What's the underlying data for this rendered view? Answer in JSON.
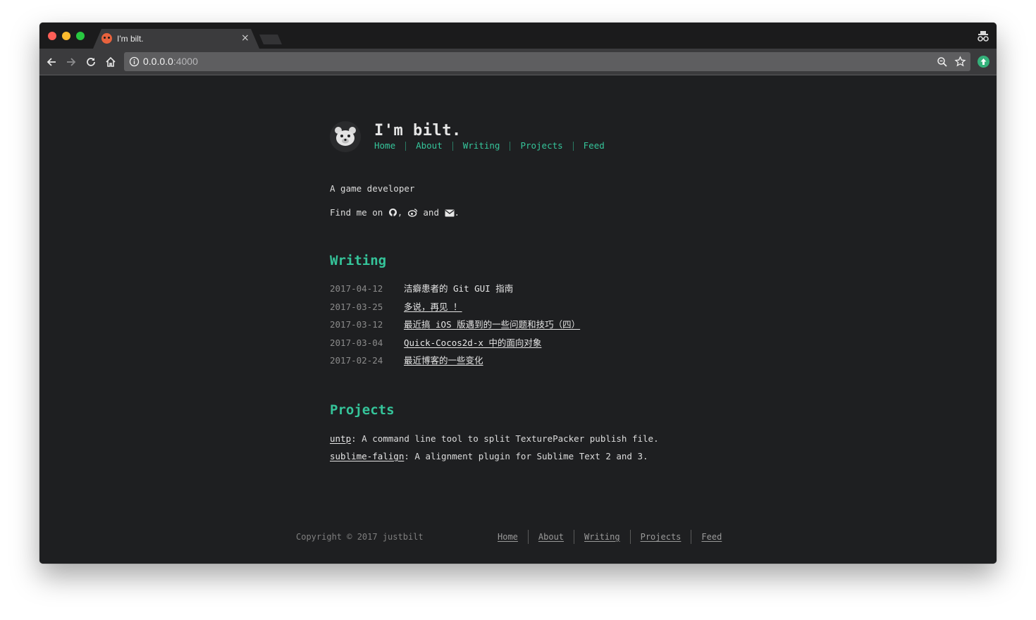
{
  "browser": {
    "tab_title": "I'm bilt.",
    "tab_close": "×",
    "url_host": "0.0.0.0",
    "url_port": ":4000"
  },
  "site": {
    "title": "I'm bilt.",
    "nav": [
      "Home",
      "About",
      "Writing",
      "Projects",
      "Feed"
    ],
    "tagline": "A game developer",
    "find_me_prefix": "Find me on",
    "find_me_comma": ",",
    "find_me_and": "and",
    "find_me_end": ".",
    "icons": [
      "github-icon",
      "weibo-icon",
      "mail-icon"
    ],
    "accent_color": "#35c49a"
  },
  "writing": {
    "heading": "Writing",
    "posts": [
      {
        "date": "2017-04-12",
        "title": "洁癖患者的 Git GUI 指南"
      },
      {
        "date": "2017-03-25",
        "title": "多说，再见 ！"
      },
      {
        "date": "2017-03-12",
        "title": "最近搞 iOS 版遇到的一些问题和技巧（四）"
      },
      {
        "date": "2017-03-04",
        "title": "Quick-Cocos2d-x 中的面向对象"
      },
      {
        "date": "2017-02-24",
        "title": "最近博客的一些变化"
      }
    ]
  },
  "projects": {
    "heading": "Projects",
    "items": [
      {
        "name": "untp",
        "description": ": A command line tool to split TexturePacker publish file."
      },
      {
        "name": "sublime-falign",
        "description": ": A alignment plugin for Sublime Text 2 and 3."
      }
    ]
  },
  "footer": {
    "copyright": "Copyright © 2017 justbilt",
    "nav": [
      "Home",
      "About",
      "Writing",
      "Projects",
      "Feed"
    ]
  }
}
